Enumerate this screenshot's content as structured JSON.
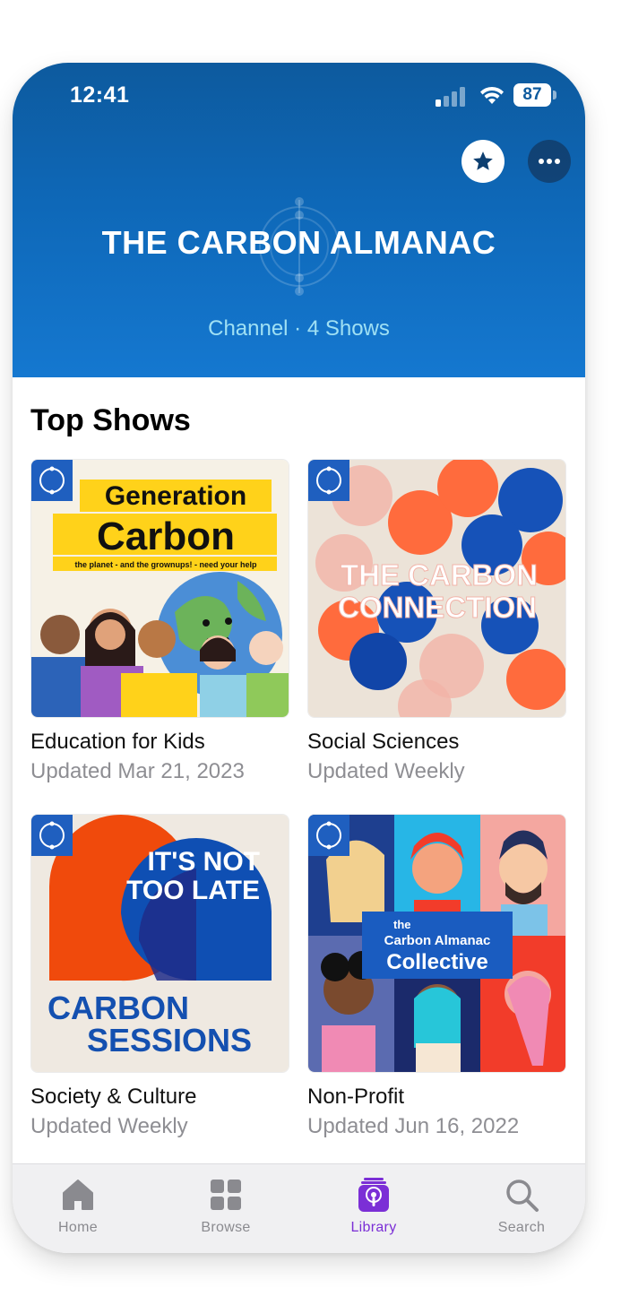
{
  "status_bar": {
    "time": "12:41",
    "battery": "87"
  },
  "header": {
    "title": "THE CARBON ALMANAC",
    "subtitle": "Channel · 4 Shows",
    "favorite_icon": "star-icon",
    "more_icon": "ellipsis-icon"
  },
  "section": {
    "title": "Top Shows"
  },
  "shows": [
    {
      "genre": "Education for Kids",
      "updated": "Updated Mar 21, 2023",
      "art_line1": "Generation",
      "art_line2": "Carbon",
      "art_tagline": "the planet - and the grownups! - need your help"
    },
    {
      "genre": "Social Sciences",
      "updated": "Updated Weekly",
      "art_line1": "THE CARBON",
      "art_line2": "CONNECTION"
    },
    {
      "genre": "Society & Culture",
      "updated": "Updated Weekly",
      "art_line1": "IT'S NOT",
      "art_line2": "TOO LATE",
      "art_line3": "CARBON",
      "art_line4": "SESSIONS"
    },
    {
      "genre": "Non-Profit",
      "updated": "Updated Jun 16, 2022",
      "art_line1": "the",
      "art_line2": "Carbon Almanac",
      "art_line3": "Collective"
    }
  ],
  "tabs": [
    {
      "label": "Home",
      "icon": "home-icon"
    },
    {
      "label": "Browse",
      "icon": "grid-icon"
    },
    {
      "label": "Library",
      "icon": "podcasts-icon",
      "active": true
    },
    {
      "label": "Search",
      "icon": "search-icon"
    }
  ],
  "colors": {
    "header_blue": "#0e68b8",
    "accent_purple": "#7b2fd6",
    "subtitle_cyan": "#9fe0f4"
  }
}
